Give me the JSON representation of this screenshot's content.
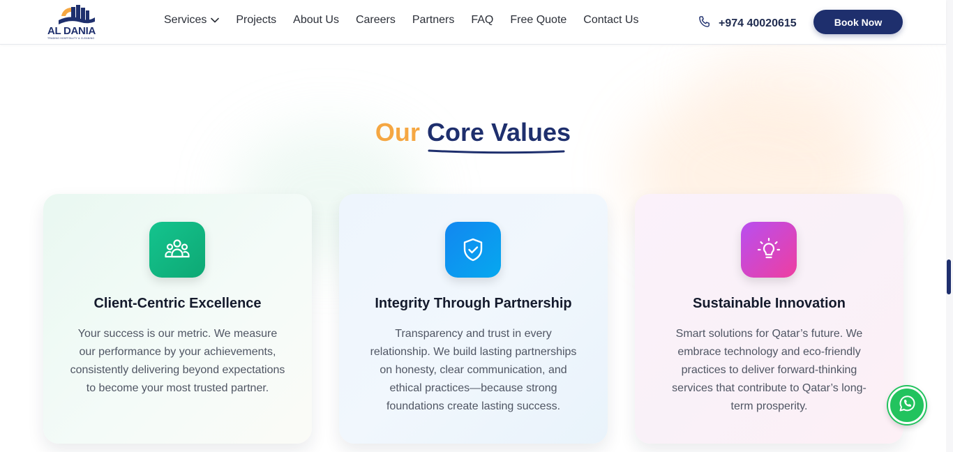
{
  "header": {
    "logo_text": "AL DANIA",
    "logo_tagline": "TRADING HOSPITALITY & CLEANING",
    "nav": [
      {
        "label": "Services",
        "has_dropdown": true
      },
      {
        "label": "Projects"
      },
      {
        "label": "About Us"
      },
      {
        "label": "Careers"
      },
      {
        "label": "Partners"
      },
      {
        "label": "FAQ"
      },
      {
        "label": "Free Quote"
      },
      {
        "label": "Contact Us"
      }
    ],
    "phone": "+974 40020615",
    "book_label": "Book Now"
  },
  "section": {
    "heading_part1": "Our",
    "heading_part2": "Core Values"
  },
  "cards": [
    {
      "icon": "users-icon",
      "title": "Client-Centric Excellence",
      "description": "Your success is our metric. We measure our performance by your achievements, consistently delivering beyond expectations to become your most trusted partner."
    },
    {
      "icon": "shield-check-icon",
      "title": "Integrity Through Partnership",
      "description": "Transparency and trust in every relationship. We build lasting partnerships on honesty, clear communication, and ethical practices—because strong foundations create lasting success."
    },
    {
      "icon": "lightbulb-icon",
      "title": "Sustainable Innovation",
      "description": "Smart solutions for Qatar’s future. We embrace technology and eco-friendly practices to deliver forward-thinking services that contribute to Qatar’s long-term prosperity."
    }
  ],
  "floating": {
    "whatsapp_icon": "whatsapp-icon"
  },
  "colors": {
    "brand_navy": "#1e2f6d",
    "accent_orange": "#f5a742",
    "green": "#14c48e",
    "blue": "#1287f0",
    "pink": "#ee3ea0",
    "whatsapp": "#22c35e"
  }
}
